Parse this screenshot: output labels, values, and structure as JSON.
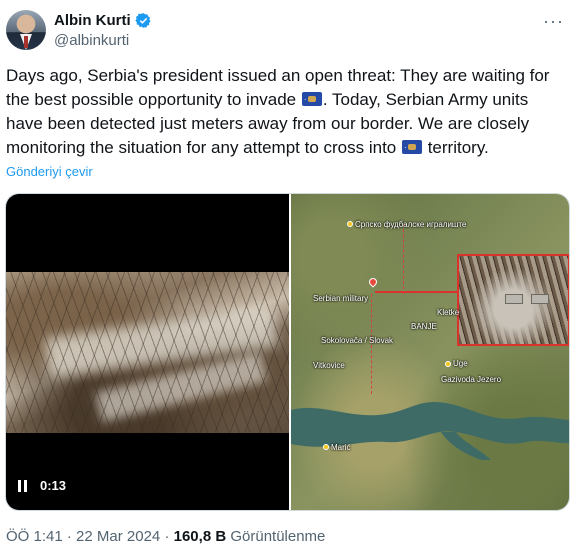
{
  "author": {
    "name": "Albin Kurti",
    "handle": "@albinkurti",
    "verified": true,
    "avatar_icon": "avatar"
  },
  "tweet": {
    "part1": "Days ago, Serbia's president issued an open threat: They are waiting for the best possible opportunity to invade ",
    "part2": ". Today, Serbian Army units have been detected just meters away from our border. We are closely monitoring the situation for any attempt to cross into ",
    "part3": " territory.",
    "flag_emoji": "kosovo-flag-icon"
  },
  "translate_label": "Gönderiyi çevir",
  "video": {
    "time": "0:13",
    "state": "playing"
  },
  "map": {
    "labels": {
      "top": "Српско фудбалске игралиште",
      "serbian": "Serbian military",
      "banje": "BANJE",
      "kletke": "Kletke",
      "village": "Sokolovača / Slovak",
      "vitkovice": "Vitkovice",
      "uge": "Uge",
      "lake": "Gazivoda Jezero",
      "bottom": "Marić"
    },
    "colors": {
      "border": "#d9332b",
      "lake": "#3f6b66"
    }
  },
  "meta": {
    "time": "ÖÖ 1:41",
    "date": "22 Mar 2024",
    "views_count": "160,8 B",
    "views_label": "Görüntülenme",
    "separator": "·"
  },
  "colors": {
    "accent": "#1d9bf0",
    "text": "#0f1419",
    "secondary": "#536471"
  }
}
